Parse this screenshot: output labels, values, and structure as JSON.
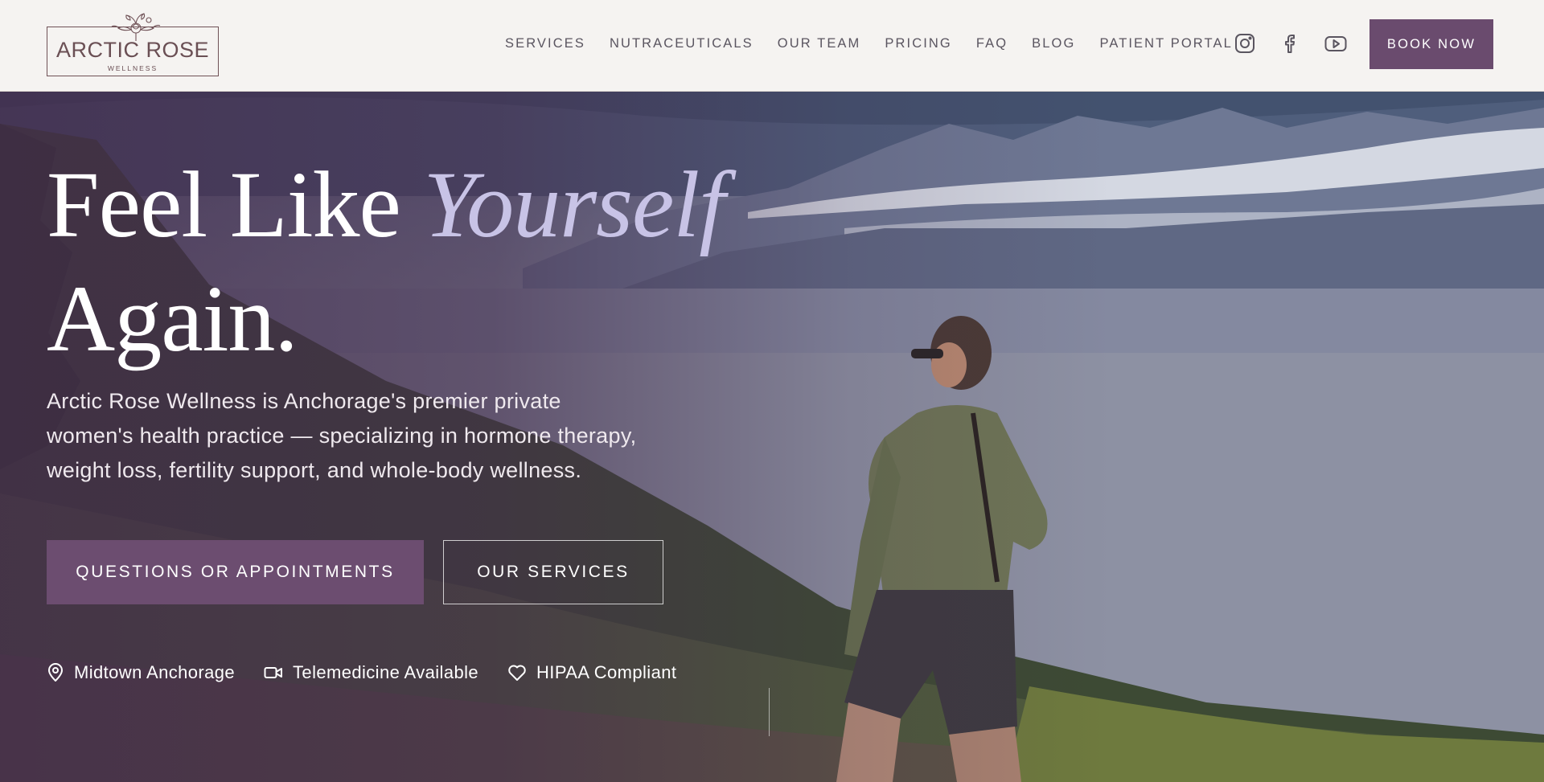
{
  "header": {
    "logo": {
      "name": "ARCTIC ROSE",
      "sub": "WELLNESS"
    },
    "nav": [
      {
        "label": "SERVICES"
      },
      {
        "label": "NUTRACEUTICALS"
      },
      {
        "label": "OUR TEAM"
      },
      {
        "label": "PRICING"
      },
      {
        "label": "FAQ"
      },
      {
        "label": "BLOG"
      },
      {
        "label": "PATIENT PORTAL"
      }
    ],
    "social_icons": [
      "instagram-icon",
      "facebook-icon",
      "youtube-icon"
    ],
    "book_label": "BOOK NOW"
  },
  "hero": {
    "title_part1": "Feel Like ",
    "title_accent": "Yourself",
    "title_part2": "Again.",
    "description": "Arctic Rose Wellness is Anchorage's premier private women's health practice — specializing in hormone therapy, weight loss, fertility support, and whole-body wellness.",
    "cta_primary": "QUESTIONS OR APPOINTMENTS",
    "cta_secondary": "OUR SERVICES",
    "features": [
      {
        "icon": "map-pin-icon",
        "label": "Midtown Anchorage"
      },
      {
        "icon": "video-camera-icon",
        "label": "Telemedicine Available"
      },
      {
        "icon": "heart-icon",
        "label": "HIPAA Compliant"
      }
    ]
  },
  "colors": {
    "brand_purple": "#6a4b6e",
    "accent_lavender": "#c8c3e6",
    "header_bg": "#f5f3f1",
    "logo_text": "#6a4f54"
  }
}
